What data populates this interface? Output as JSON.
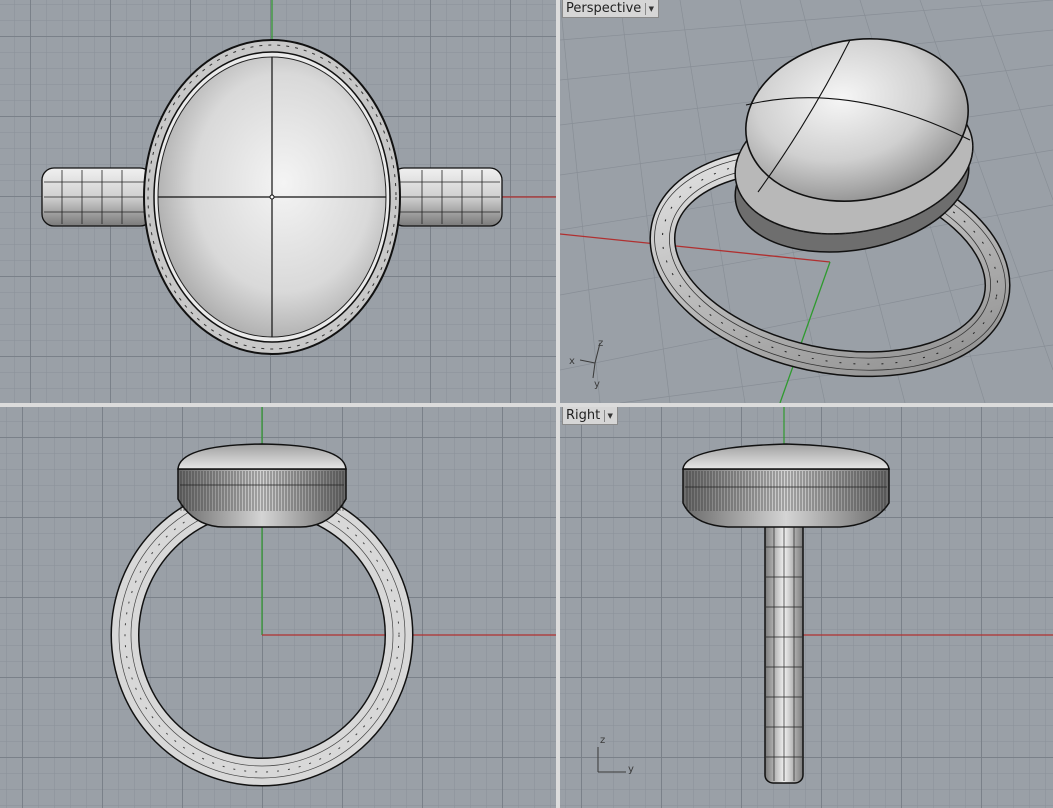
{
  "viewports": {
    "top": {
      "title": ""
    },
    "perspective": {
      "title": "Perspective"
    },
    "front": {
      "title": ""
    },
    "right": {
      "title": "Right"
    }
  },
  "axes": {
    "x": "x",
    "y": "y",
    "z": "z"
  },
  "colors": {
    "background": "#9aa0a7",
    "grid": "#7e848c",
    "x_axis": "#b03030",
    "y_axis": "#2f9a2f",
    "separator": "#dcdcdc"
  },
  "icons": {
    "dropdown": "chevron-down-icon"
  }
}
